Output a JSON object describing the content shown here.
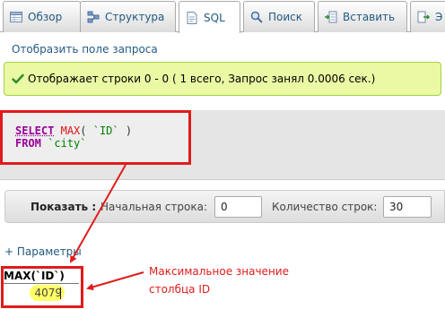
{
  "tabs": [
    {
      "label": "Обзор",
      "icon": "browse-icon"
    },
    {
      "label": "Структура",
      "icon": "structure-icon"
    },
    {
      "label": "SQL",
      "icon": "sql-icon"
    },
    {
      "label": "Поиск",
      "icon": "search-icon"
    },
    {
      "label": "Вставить",
      "icon": "insert-icon"
    },
    {
      "label": "Э",
      "icon": "export-icon"
    }
  ],
  "active_tab": "SQL",
  "show_query_link": "Отобразить поле запроса",
  "message": {
    "text": "Отображает строки 0 - 0 ( 1 всего, Запрос занял 0.0006 сек.)",
    "color": "#ebf8a4"
  },
  "sql": {
    "kw_select": "SELECT",
    "fn_max": "MAX",
    "open": "( ",
    "column": "`ID`",
    "close": " )",
    "kw_from": "FROM",
    "table": "`city`"
  },
  "pager": {
    "show_label": "Показать :",
    "start_label": "Начальная строка:",
    "start_value": "0",
    "rows_label": "Количество строк:",
    "rows_value": "30"
  },
  "options_link": "+ Параметры",
  "result": {
    "header": "MAX(`ID`)",
    "value": "4079"
  },
  "annotation": {
    "line1": "Максимальное значение",
    "line2": "столбца ID",
    "color": "#e01b1b"
  }
}
